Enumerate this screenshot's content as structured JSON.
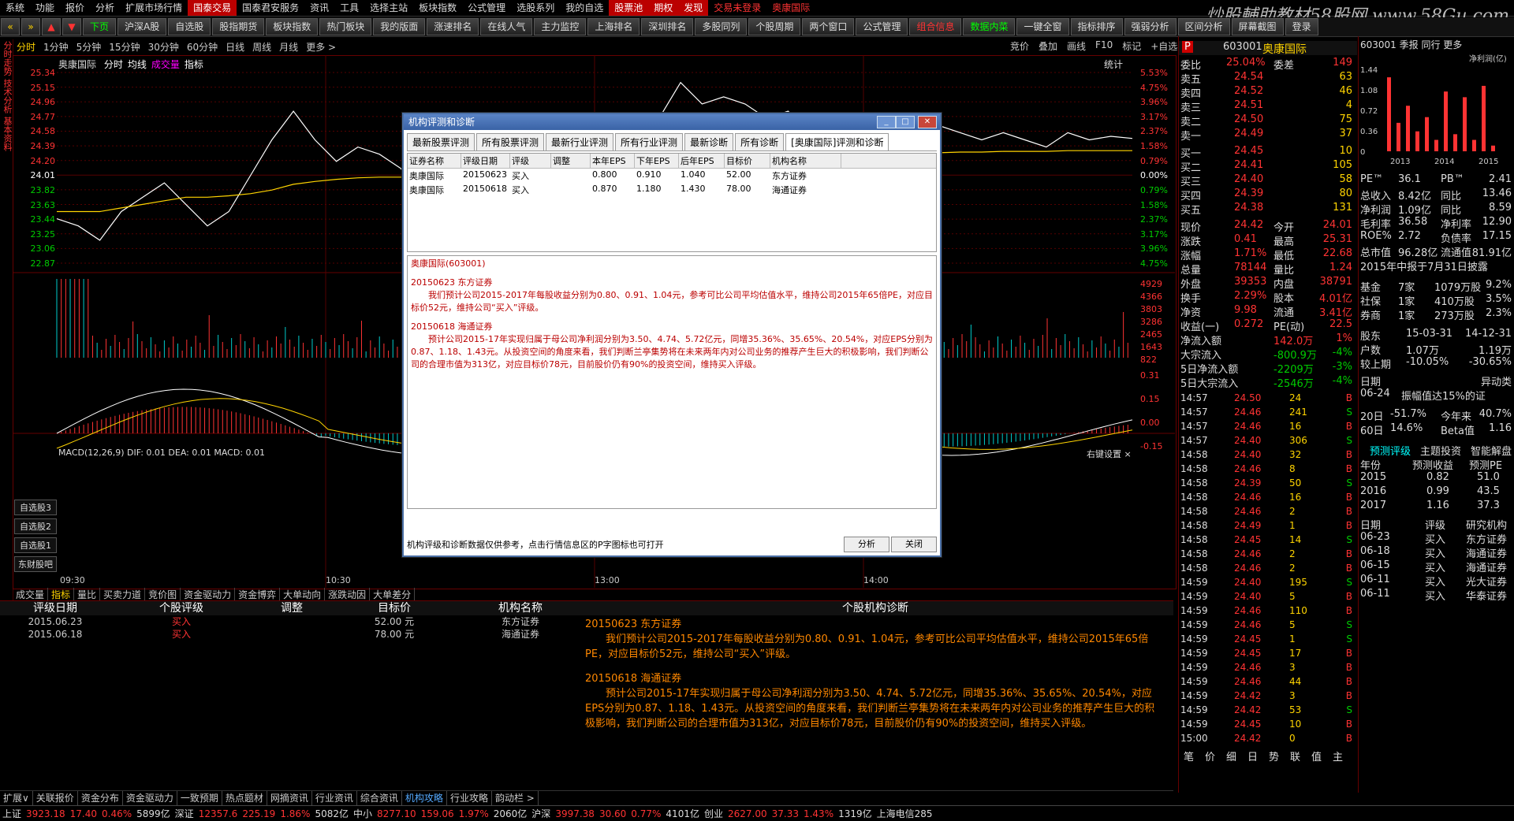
{
  "menu": [
    "系统",
    "功能",
    "报价",
    "分析",
    "扩展市场行情",
    "国泰交易",
    "国泰君安服务",
    "资讯",
    "工具",
    "选择主站",
    "板块指数",
    "公式管理",
    "选股系列",
    "我的自选",
    "股票池",
    "期权",
    "发现",
    "交易未登录",
    "奥康国际"
  ],
  "watermark": "炒股輔助教材58股网 www.58Gu.com",
  "toolbar": [
    "下页",
    "沪深A股",
    "自选股",
    "股指期货",
    "板块指数",
    "热门板块",
    "我的版面",
    "涨速排名",
    "在线人气",
    "主力监控",
    "上海排名",
    "深圳排名",
    "多股同列",
    "个股周期",
    "两个窗口",
    "公式管理",
    "组合信息",
    "数据内菜",
    "一键全窗",
    "指标排序",
    "强弱分析",
    "区间分析",
    "屏幕截图",
    "登录"
  ],
  "periods": [
    "分时",
    "1分钟",
    "5分钟",
    "15分钟",
    "30分钟",
    "60分钟",
    "日线",
    "周线",
    "月线",
    "更多 >"
  ],
  "chart_tools": [
    "竞价",
    "叠加",
    "画线",
    "F10",
    "标记",
    "+自选"
  ],
  "vtabs": [
    "分时走势",
    "技术分析",
    "基本资料"
  ],
  "chart_header": {
    "name": "奥康国际",
    "items": [
      "分时",
      "均线",
      "成交量",
      "指标"
    ],
    "right": "统计"
  },
  "price_axis_left": [
    "25.34",
    "25.15",
    "24.96",
    "24.77",
    "24.58",
    "24.39",
    "24.20",
    "24.01",
    "23.82",
    "23.63",
    "23.44",
    "23.25",
    "23.06",
    "22.87"
  ],
  "price_axis_right": [
    "5.53%",
    "4.75%",
    "3.96%",
    "3.17%",
    "2.37%",
    "1.58%",
    "0.79%",
    "0.00%",
    "0.79%",
    "1.58%",
    "2.37%",
    "3.17%",
    "3.96%",
    "4.75%"
  ],
  "vol_axis_right": [
    "4929",
    "4366",
    "3803",
    "3286",
    "2465",
    "1643",
    "822"
  ],
  "macd_label": "MACD(12,26,9) DIF: 0.01  DEA: 0.01  MACD: 0.01",
  "macd_axis": [
    "0.31",
    "0.15",
    "0.00",
    "-0.15"
  ],
  "macd_right_label": "右键设置 ×",
  "time_axis": [
    "09:30",
    "10:30",
    "13:00",
    "14:00"
  ],
  "side_buttons": [
    "自选股3",
    "自选股2",
    "自选股1",
    "东财股吧"
  ],
  "dialog": {
    "title": "机构评测和诊断",
    "tabs": [
      "最新股票评测",
      "所有股票评测",
      "最新行业评测",
      "所有行业评测",
      "最新诊断",
      "所有诊断",
      "[奥康国际]评测和诊断"
    ],
    "columns": [
      "证券名称",
      "评级日期",
      "评级",
      "调整",
      "本年EPS",
      "下年EPS",
      "后年EPS",
      "目标价",
      "机构名称"
    ],
    "rows": [
      [
        "奥康国际",
        "20150623",
        "买入",
        "",
        "0.800",
        "0.910",
        "1.040",
        "52.00",
        "东方证券"
      ],
      [
        "奥康国际",
        "20150618",
        "买入",
        "",
        "0.870",
        "1.180",
        "1.430",
        "78.00",
        "海通证券"
      ]
    ],
    "diag_head": "奥康国际(603001)",
    "diag": [
      {
        "head": "20150623 东方证券",
        "body": "我们预计公司2015-2017年每股收益分别为0.80、0.91、1.04元，参考可比公司平均估值水平，维持公司2015年65倍PE，对应目标价52元，维持公司“买入”评级。"
      },
      {
        "head": "20150618 海通证券",
        "body": "预计公司2015-17年实现归属于母公司净利润分别为3.50、4.74、5.72亿元，同增35.36%、35.65%、20.54%，对应EPS分别为0.87、1.18、1.43元。从投资空间的角度来看，我们判断兰亭集势将在未来两年内对公司业务的推荐产生巨大的积极影响，我们判断公司的合理市值为313亿，对应目标价78元，目前股价仍有90%的投资空间，维持买入评级。"
      }
    ],
    "footer": "机构评级和诊断数据仅供参考，点击行情信息区的P字图标也可打开",
    "btn_analyze": "分析",
    "btn_close": "关闭"
  },
  "subtabs": [
    "成交量",
    "指标",
    "量比",
    "买卖力道",
    "竞价图",
    "资金驱动力",
    "资金博弈",
    "大单动向",
    "涨跌动因",
    "大单差分"
  ],
  "bottom_panel": {
    "headers": [
      "评级日期",
      "个股评级",
      "调整",
      "目标价",
      "机构名称",
      "个股机构诊断"
    ],
    "rows": [
      [
        "2015.06.23",
        "买入",
        "",
        "52.00 元",
        "东方证券"
      ],
      [
        "2015.06.18",
        "买入",
        "",
        "78.00 元",
        "海通证券"
      ]
    ]
  },
  "bottom_tabs": [
    "扩展∨",
    "关联报价",
    "资金分布",
    "资金驱动力",
    "一致预期",
    "热点题材",
    "网摘资讯",
    "行业资讯",
    "综合资讯",
    "机构攻略",
    "行业攻略",
    "韵动栏 >"
  ],
  "status": [
    {
      "t": "上证",
      "c": "w"
    },
    {
      "t": "3923.18",
      "c": "r"
    },
    {
      "t": "17.40",
      "c": "r"
    },
    {
      "t": "0.46%",
      "c": "r"
    },
    {
      "t": "5899亿",
      "c": "w"
    },
    {
      "t": "深证",
      "c": "w"
    },
    {
      "t": "12357.6",
      "c": "r"
    },
    {
      "t": "225.19",
      "c": "r"
    },
    {
      "t": "1.86%",
      "c": "r"
    },
    {
      "t": "5082亿",
      "c": "w"
    },
    {
      "t": "中小",
      "c": "w"
    },
    {
      "t": "8277.10",
      "c": "r"
    },
    {
      "t": "159.06",
      "c": "r"
    },
    {
      "t": "1.97%",
      "c": "r"
    },
    {
      "t": "2060亿",
      "c": "w"
    },
    {
      "t": "沪深",
      "c": "w"
    },
    {
      "t": "3997.38",
      "c": "r"
    },
    {
      "t": "30.60",
      "c": "r"
    },
    {
      "t": "0.77%",
      "c": "r"
    },
    {
      "t": "4101亿",
      "c": "w"
    },
    {
      "t": "创业",
      "c": "w"
    },
    {
      "t": "2627.00",
      "c": "r"
    },
    {
      "t": "37.33",
      "c": "r"
    },
    {
      "t": "1.43%",
      "c": "r"
    },
    {
      "t": "1319亿",
      "c": "w"
    },
    {
      "t": "上海电信285",
      "c": "w"
    }
  ],
  "quote": {
    "code": "603001",
    "name": "奥康国际",
    "weibi": {
      "label": "委比",
      "value": "25.04%",
      "label2": "委差",
      "value2": "149"
    },
    "sell": [
      [
        "卖五",
        "24.54",
        "63"
      ],
      [
        "卖四",
        "24.52",
        "46"
      ],
      [
        "卖三",
        "24.51",
        "4"
      ],
      [
        "卖二",
        "24.50",
        "75"
      ],
      [
        "卖一",
        "24.49",
        "37"
      ]
    ],
    "buy": [
      [
        "买一",
        "24.45",
        "10"
      ],
      [
        "买二",
        "24.41",
        "105"
      ],
      [
        "买三",
        "24.40",
        "58"
      ],
      [
        "买四",
        "24.39",
        "80"
      ],
      [
        "买五",
        "24.38",
        "131"
      ]
    ],
    "stats": [
      [
        "现价",
        "24.42",
        "今开",
        "24.01"
      ],
      [
        "涨跌",
        "0.41",
        "最高",
        "25.31"
      ],
      [
        "涨幅",
        "1.71%",
        "最低",
        "22.68"
      ],
      [
        "总量",
        "78144",
        "量比",
        "1.24"
      ],
      [
        "外盘",
        "39353",
        "内盘",
        "38791"
      ],
      [
        "换手",
        "2.29%",
        "股本",
        "4.01亿"
      ],
      [
        "净资",
        "9.98",
        "流通",
        "3.41亿"
      ],
      [
        "收益(一)",
        "0.272",
        "PE(动)",
        "22.5"
      ]
    ],
    "flows": [
      [
        "净流入额",
        "142.0万",
        "1%"
      ],
      [
        "大宗流入",
        "-800.9万",
        "-4%"
      ],
      [
        "5日净流入额",
        "-2209万",
        "-3%"
      ],
      [
        "5日大宗流入",
        "-2546万",
        "-4%"
      ]
    ],
    "ticks": [
      [
        "14:57",
        "24.50",
        "24",
        "B"
      ],
      [
        "14:57",
        "24.46",
        "241",
        "S"
      ],
      [
        "14:57",
        "24.46",
        "16",
        "B"
      ],
      [
        "14:57",
        "24.40",
        "306",
        "S"
      ],
      [
        "14:58",
        "24.40",
        "32",
        "B"
      ],
      [
        "14:58",
        "24.46",
        "8",
        "B"
      ],
      [
        "14:58",
        "24.39",
        "50",
        "S"
      ],
      [
        "14:58",
        "24.46",
        "16",
        "B"
      ],
      [
        "14:58",
        "24.46",
        "2",
        "B"
      ],
      [
        "14:58",
        "24.49",
        "1",
        "B"
      ],
      [
        "14:58",
        "24.45",
        "14",
        "S"
      ],
      [
        "14:58",
        "24.46",
        "2",
        "B"
      ],
      [
        "14:58",
        "24.46",
        "2",
        "B"
      ],
      [
        "14:59",
        "24.40",
        "195",
        "S"
      ],
      [
        "14:59",
        "24.40",
        "5",
        "B"
      ],
      [
        "14:59",
        "24.46",
        "110",
        "B"
      ],
      [
        "14:59",
        "24.46",
        "5",
        "S"
      ],
      [
        "14:59",
        "24.45",
        "1",
        "S"
      ],
      [
        "14:59",
        "24.45",
        "17",
        "B"
      ],
      [
        "14:59",
        "24.46",
        "3",
        "B"
      ],
      [
        "14:59",
        "24.46",
        "44",
        "B"
      ],
      [
        "14:59",
        "24.42",
        "3",
        "B"
      ],
      [
        "14:59",
        "24.42",
        "53",
        "S"
      ],
      [
        "14:59",
        "24.45",
        "10",
        "B"
      ],
      [
        "15:00",
        "24.42",
        "0",
        "B"
      ]
    ],
    "bottom_tabs": [
      "笔",
      "价",
      "细",
      "日",
      "势",
      "联",
      "值",
      "主"
    ]
  },
  "far": {
    "header": "603001  季报 同行 更多",
    "bar_chart": {
      "type": "bar",
      "ylabel": "净利润(亿)",
      "yticks": [
        "1.44",
        "1.08",
        "0.72",
        "0.36",
        "0"
      ],
      "xlabels": [
        "2013",
        "2014",
        "2015"
      ],
      "values": [
        1.3,
        0.5,
        0.8,
        0.35,
        0.6,
        0.2,
        1.05,
        0.3,
        0.95,
        0.2,
        1.15,
        0.1
      ]
    },
    "fin": [
      [
        "PE™",
        "36.1",
        "PB™",
        "2.41"
      ],
      [
        "总收入",
        "8.42亿",
        "同比",
        "13.46"
      ],
      [
        "净利润",
        "1.09亿",
        "同比",
        "8.59"
      ],
      [
        "毛利率",
        "36.58",
        "净利率",
        "12.90"
      ],
      [
        "ROE%",
        "2.72",
        "负债率",
        "17.15"
      ],
      [
        "总市值",
        "96.28亿",
        "流通值",
        "81.91亿"
      ]
    ],
    "report_note": "2015年中报于7月31日披露",
    "holders": [
      [
        "基金",
        "7家",
        "1079万股",
        "9.2%"
      ],
      [
        "社保",
        "1家",
        "410万股",
        "3.5%"
      ],
      [
        "券商",
        "1家",
        "273万股",
        "2.3%"
      ]
    ],
    "dates": [
      [
        "股东",
        "15-03-31",
        "14-12-31"
      ],
      [
        "户数",
        "1.07万",
        "1.19万"
      ],
      [
        "较上期",
        "-10.05%",
        "-30.65%"
      ]
    ],
    "event_head": [
      "日期",
      "异动类"
    ],
    "event": [
      "06-24",
      "振幅值达15%的证"
    ],
    "perf": [
      [
        "20日",
        "-51.7%",
        "今年来",
        "40.7%"
      ],
      [
        "60日",
        "14.6%",
        "Beta值",
        "1.16"
      ]
    ],
    "forecast_tabs": [
      "预测评级",
      "主题投资",
      "智能解盘"
    ],
    "forecast_head": [
      "年份",
      "预测收益",
      "预测PE"
    ],
    "forecast": [
      [
        "2015",
        "0.82",
        "51.0"
      ],
      [
        "2016",
        "0.99",
        "43.5"
      ],
      [
        "2017",
        "1.16",
        "37.3"
      ]
    ],
    "rating_head": [
      "日期",
      "评级",
      "研究机构"
    ],
    "ratings": [
      [
        "06-23",
        "买入",
        "东方证券"
      ],
      [
        "06-18",
        "买入",
        "海通证券"
      ],
      [
        "06-15",
        "买入",
        "海通证券"
      ],
      [
        "06-11",
        "买入",
        "光大证券"
      ],
      [
        "06-11",
        "买入",
        "华泰证券"
      ]
    ]
  },
  "chart_data": {
    "type": "line",
    "title": "奥康国际 分时",
    "ylim": [
      22.68,
      25.34
    ],
    "price": [
      23.3,
      23.2,
      23.0,
      23.4,
      23.6,
      23.8,
      23.5,
      23.2,
      23.4,
      23.9,
      24.4,
      24.8,
      24.4,
      24.1,
      24.3,
      24.2,
      24.0,
      23.5,
      23.3,
      23.9,
      24.2,
      24.0,
      23.9,
      24.2,
      24.6,
      24.5,
      24.0,
      24.3,
      24.7,
      25.2,
      24.9,
      25.0,
      24.9,
      24.7,
      24.8,
      24.5,
      24.4,
      24.3,
      24.2,
      24.4,
      24.5,
      24.6,
      24.5,
      24.4,
      24.5,
      24.4,
      24.3,
      24.5,
      24.4,
      24.45,
      24.42
    ],
    "avg": [
      23.4,
      23.4,
      23.4,
      23.45,
      23.5,
      23.55,
      23.6,
      23.6,
      23.62,
      23.65,
      23.7,
      23.78,
      23.82,
      23.85,
      23.87,
      23.88,
      23.88,
      23.87,
      23.86,
      23.87,
      23.9,
      23.92,
      23.93,
      23.95,
      23.98,
      24.0,
      24.0,
      24.02,
      24.05,
      24.08,
      24.1,
      24.12,
      24.14,
      24.16,
      24.17,
      24.18,
      24.19,
      24.2,
      24.2,
      24.21,
      24.22,
      24.22,
      24.23,
      24.23,
      24.24,
      24.24,
      24.24,
      24.25,
      24.25,
      24.25,
      24.25
    ]
  }
}
